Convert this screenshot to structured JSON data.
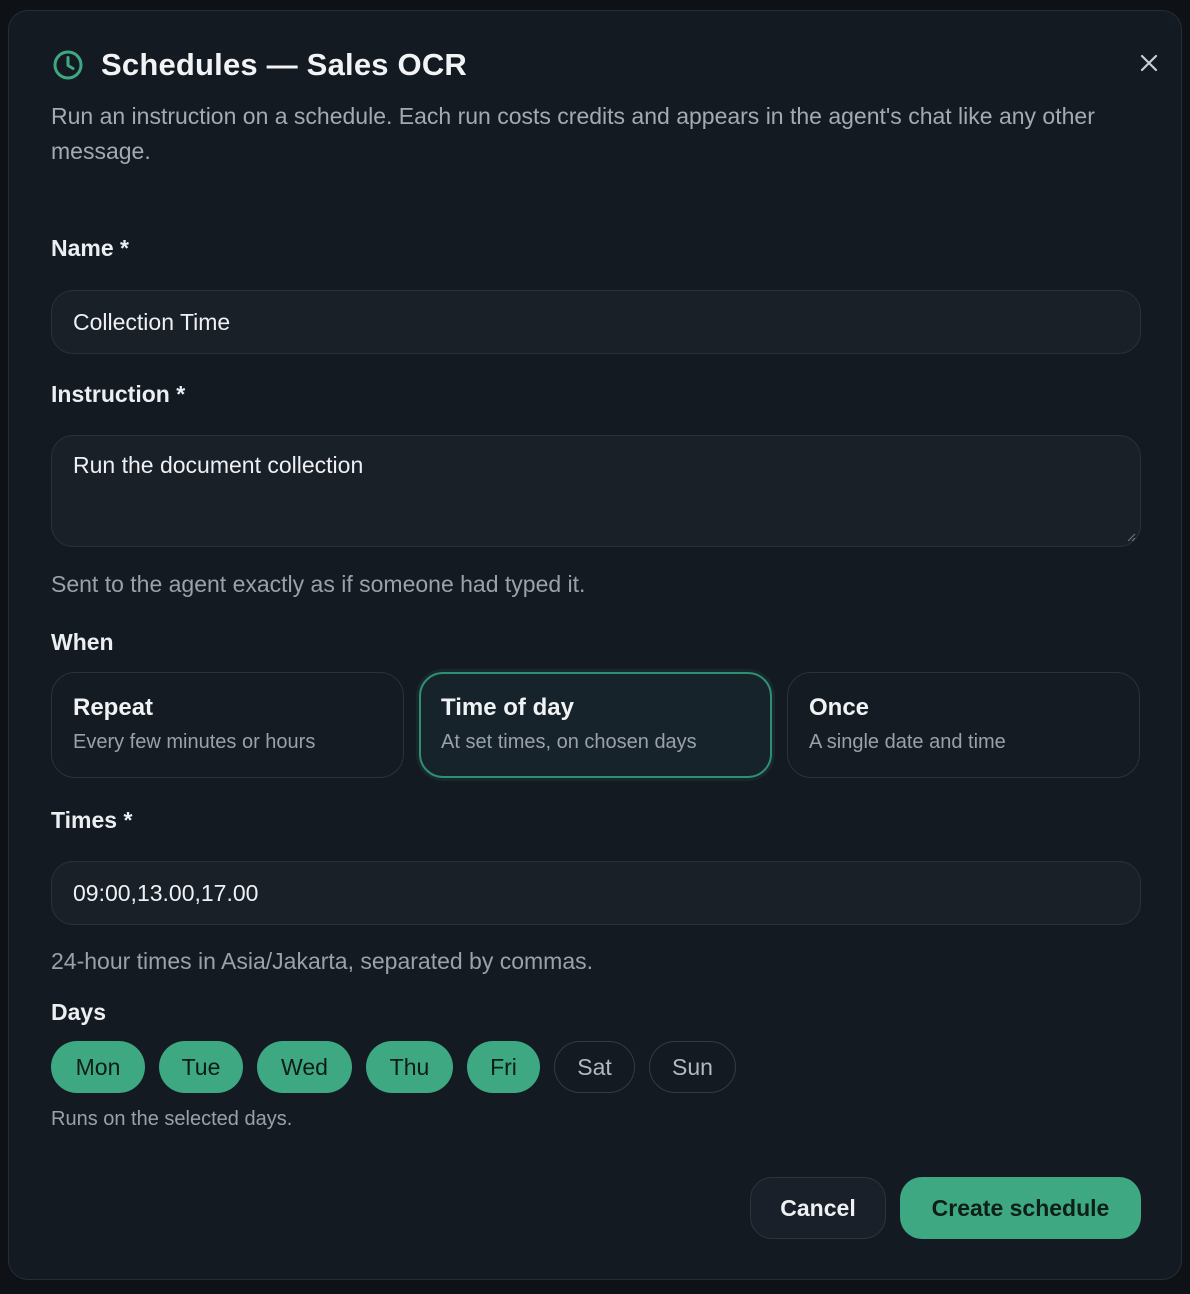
{
  "dialog": {
    "title": "Schedules — Sales OCR",
    "subtitle": "Run an instruction on a schedule. Each run costs credits and appears in the agent's chat like any other message.",
    "icons": {
      "title": "clock-icon",
      "close": "close-icon"
    },
    "accent_color": "#3ea883"
  },
  "form": {
    "name": {
      "label": "Name *",
      "value": "Collection Time"
    },
    "instruction": {
      "label": "Instruction *",
      "value": "Run the document collection",
      "help": "Sent to the agent exactly as if someone had typed it."
    },
    "when": {
      "label": "When",
      "options": [
        {
          "title": "Repeat",
          "description": "Every few minutes or hours",
          "selected": false
        },
        {
          "title": "Time of day",
          "description": "At set times, on chosen days",
          "selected": true
        },
        {
          "title": "Once",
          "description": "A single date and time",
          "selected": false
        }
      ]
    },
    "times": {
      "label": "Times *",
      "value": "09:00,13.00,17.00",
      "help": "24-hour times in Asia/Jakarta, separated by commas."
    },
    "days": {
      "label": "Days",
      "items": [
        {
          "label": "Mon",
          "selected": true
        },
        {
          "label": "Tue",
          "selected": true
        },
        {
          "label": "Wed",
          "selected": true
        },
        {
          "label": "Thu",
          "selected": true
        },
        {
          "label": "Fri",
          "selected": true
        },
        {
          "label": "Sat",
          "selected": false
        },
        {
          "label": "Sun",
          "selected": false
        }
      ],
      "help": "Runs on the selected days."
    }
  },
  "actions": {
    "cancel_label": "Cancel",
    "create_label": "Create schedule"
  }
}
